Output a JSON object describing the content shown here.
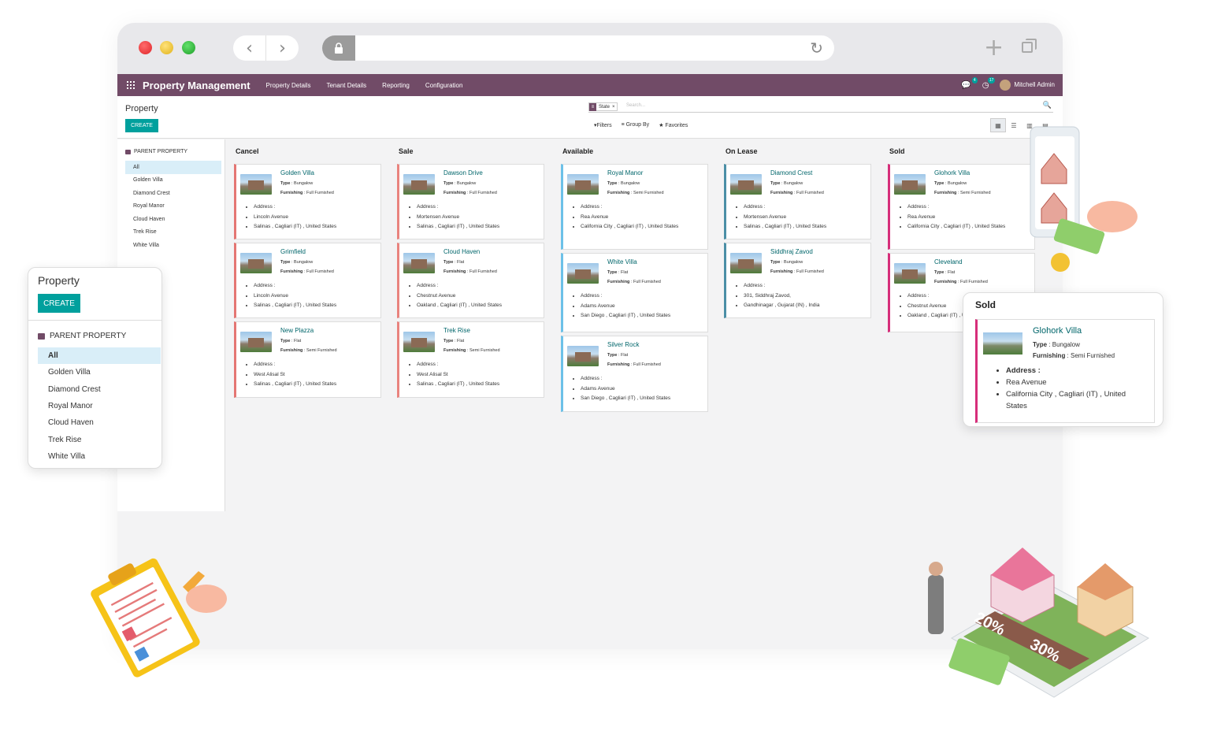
{
  "browser": {
    "back": "‹",
    "forward": "›",
    "reload": "↻",
    "new_tab": "+"
  },
  "topbar": {
    "app_title": "Property Management",
    "menu": [
      "Property Details",
      "Tenant Details",
      "Reporting",
      "Configuration"
    ],
    "messages_count": "4",
    "activities_count": "17",
    "user": "Mitchell Admin"
  },
  "control_panel": {
    "breadcrumb": "Property",
    "create_label": "CREATE",
    "facet": "State",
    "search_placeholder": "Search...",
    "filters_label": "Filters",
    "groupby_label": "Group By",
    "favorites_label": "Favorites"
  },
  "side_panel": {
    "header": "PARENT PROPERTY",
    "items": [
      "All",
      "Golden Villa",
      "Diamond Crest",
      "Royal Manor",
      "Cloud Haven",
      "Trek Rise",
      "White Villa"
    ]
  },
  "labels": {
    "type": "Type",
    "furnishing": "Furnishing",
    "address": "Address :"
  },
  "columns": [
    {
      "title": "Cancel",
      "cards": [
        {
          "name": "Golden Villa",
          "type": "Bungalow",
          "furnishing": "Full Furnished",
          "street": "Lincoln Avenue",
          "city": "Salinas , Cagliari (IT) , United States"
        },
        {
          "name": "Grimfield",
          "type": "Bungalow",
          "furnishing": "Full Furnished",
          "street": "Lincoln Avenue",
          "city": "Salinas , Cagliari (IT) , United States"
        },
        {
          "name": "New Plazza",
          "type": "Flat",
          "furnishing": "Semi Furnished",
          "street": "West Alisal St",
          "city": "Salinas , Cagliari (IT) , United States"
        }
      ]
    },
    {
      "title": "Sale",
      "cards": [
        {
          "name": "Dawson Drive",
          "type": "Bungalow",
          "furnishing": "Full Furnished",
          "street": "Mortensen Avenue",
          "city": "Salinas , Cagliari (IT) , United States"
        },
        {
          "name": "Cloud Haven",
          "type": "Flat",
          "furnishing": "Full Furnished",
          "street": "Chestnut Avenue",
          "city": "Oakland , Cagliari (IT) , United States"
        },
        {
          "name": "Trek Rise",
          "type": "Flat",
          "furnishing": "Semi Furnished",
          "street": "West Alisal St",
          "city": "Salinas , Cagliari (IT) , United States"
        }
      ]
    },
    {
      "title": "Available",
      "cards": [
        {
          "name": "Royal Manor",
          "type": "Bungalow",
          "furnishing": "Semi Furnished",
          "street": "Rea Avenue",
          "city": "California City , Cagliari (IT) , United States"
        },
        {
          "name": "White Villa",
          "type": "Flat",
          "furnishing": "Full Furnished",
          "street": "Adams Avenue",
          "city": "San Diego , Cagliari (IT) , United States"
        },
        {
          "name": "Silver Rock",
          "type": "Flat",
          "furnishing": "Full Furnished",
          "street": "Adams Avenue",
          "city": "San Diego , Cagliari (IT) , United States"
        }
      ]
    },
    {
      "title": "On Lease",
      "cards": [
        {
          "name": "Diamond Crest",
          "type": "Bungalow",
          "furnishing": "Full Furnished",
          "street": "Mortensen Avenue",
          "city": "Salinas , Cagliari (IT) , United States"
        },
        {
          "name": "Siddhraj Zavod",
          "type": "Bungalow",
          "furnishing": "Full Furnished",
          "street": "301, Siddhraj Zavod,",
          "city": "Gandhinagar , Gujarat (IN) , India"
        }
      ]
    },
    {
      "title": "Sold",
      "cards": [
        {
          "name": "Glohork Villa",
          "type": "Bungalow",
          "furnishing": "Semi Furnished",
          "street": "Rea Avenue",
          "city": "California City , Cagliari (IT) , United States"
        },
        {
          "name": "Cleveland",
          "type": "Flat",
          "furnishing": "Full Furnished",
          "street": "Chestnut Avenue",
          "city": "Oakland , Cagliari (IT) , United States"
        }
      ]
    }
  ],
  "zoom_property": {
    "breadcrumb": "Property",
    "create_label": "CREATE",
    "header": "PARENT PROPERTY",
    "items": [
      "All",
      "Golden Villa",
      "Diamond Crest",
      "Royal Manor",
      "Cloud Haven",
      "Trek Rise",
      "White Villa"
    ]
  },
  "zoom_sold": {
    "title": "Sold",
    "name": "Glohork Villa",
    "type": "Bungalow",
    "furnishing": "Semi Furnished",
    "street": "Rea Avenue",
    "city": "California City , Cagliari (IT) , United States"
  },
  "illustration": {
    "label_a": "20%",
    "label_b": "30%"
  },
  "colors": {
    "brand": "#714b67",
    "accent": "#00a09d",
    "link": "#01666b"
  }
}
